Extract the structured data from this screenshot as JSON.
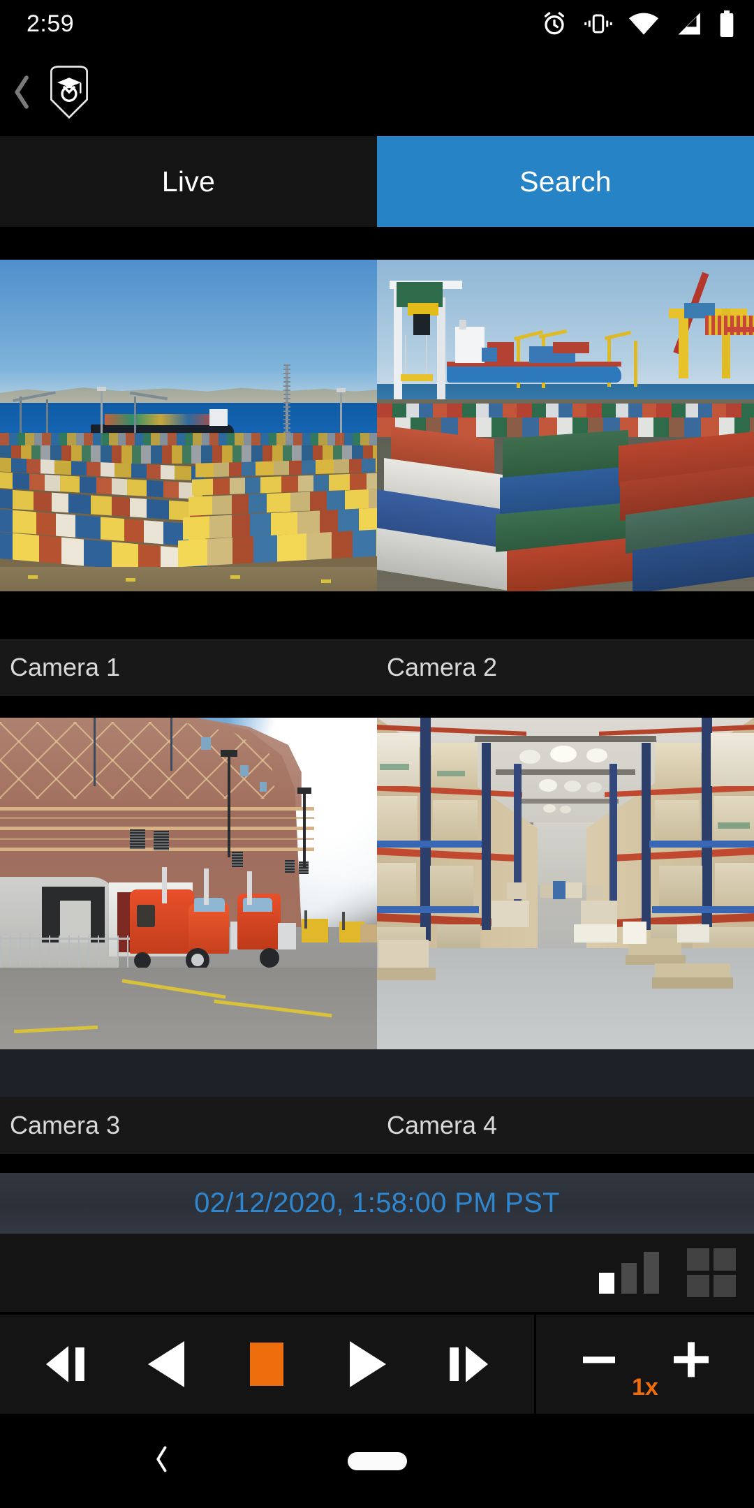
{
  "status_bar": {
    "clock": "2:59",
    "icons": [
      "alarm-clock-icon",
      "vibrate-icon",
      "wifi-icon",
      "cellular-signal-icon",
      "battery-icon"
    ]
  },
  "app_bar": {
    "back_icon": "back-chevron-icon",
    "logo_icon": "shield-graduation-cap-logo"
  },
  "tabs": [
    {
      "label": "Live",
      "active": false
    },
    {
      "label": "Search",
      "active": true
    }
  ],
  "colors": {
    "tab_active": "#2684c6",
    "timestamp_text": "#2f87cf",
    "accent_orange": "#ef6c0a",
    "panel_dark": "#141414",
    "label_strip": "#181818"
  },
  "camera_grid": {
    "layout": "2x2",
    "cameras": [
      {
        "label": "Camera 1",
        "scene": "container-port-aerial"
      },
      {
        "label": "Camera 2",
        "scene": "port-gantry-cranes"
      },
      {
        "label": "Camera 3",
        "scene": "truck-loading-dock"
      },
      {
        "label": "Camera 4",
        "scene": "warehouse-aisle"
      }
    ]
  },
  "timestamp": {
    "value": "02/12/2020, 1:58:00 PM PST"
  },
  "options_toolbar": {
    "quality_icon": "signal-bars-icon",
    "layout_icon": "grid-2x2-icon"
  },
  "playback": {
    "buttons": [
      {
        "name": "step-backward-button",
        "icon": "step-backward-icon"
      },
      {
        "name": "rewind-button",
        "icon": "rewind-icon"
      },
      {
        "name": "stop-button",
        "icon": "stop-icon"
      },
      {
        "name": "play-button",
        "icon": "play-icon"
      },
      {
        "name": "step-forward-button",
        "icon": "step-forward-icon"
      }
    ],
    "speed_label": "1x",
    "decrease_icon": "minus-icon",
    "increase_icon": "plus-icon"
  },
  "nav_bar": {
    "back_icon": "nav-back-icon",
    "home_icon": "nav-home-pill-icon"
  }
}
